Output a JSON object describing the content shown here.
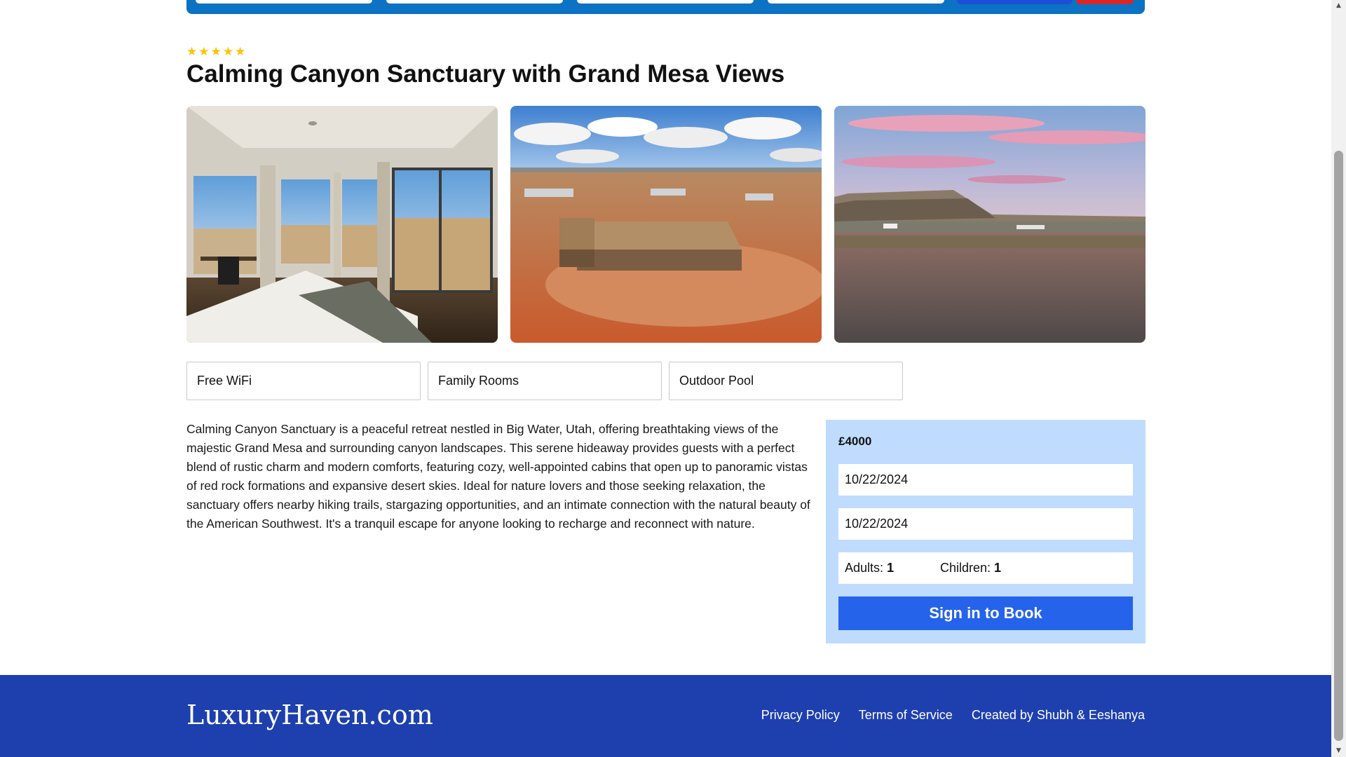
{
  "hotel": {
    "rating": 5,
    "rating_stars": [
      "★",
      "★",
      "★",
      "★",
      "★"
    ],
    "title": "Calming Canyon Sanctuary with Grand Mesa Views",
    "photos": [
      {
        "subject": "bedroom-window-view"
      },
      {
        "subject": "aerial-desert-house"
      },
      {
        "subject": "sunset-mesa-landscape"
      }
    ],
    "facilities": [
      "Free WiFi",
      "Family Rooms",
      "Outdoor Pool"
    ],
    "description": "Calming Canyon Sanctuary is a peaceful retreat nestled in Big Water, Utah, offering breathtaking views of the majestic Grand Mesa and surrounding canyon landscapes. This serene hideaway provides guests with a perfect blend of rustic charm and modern comforts, featuring cozy, well-appointed cabins that open up to panoramic vistas of red rock formations and expansive desert skies. Ideal for nature lovers and those seeking relaxation, the sanctuary offers nearby hiking trails, stargazing opportunities, and an intimate connection with the natural beauty of the American Southwest. It's a tranquil escape for anyone looking to recharge and reconnect with nature."
  },
  "booking": {
    "price": "£4000",
    "check_in": "10/22/2024",
    "check_out": "10/22/2024",
    "adults_label": "Adults:",
    "adults_value": "1",
    "children_label": "Children:",
    "children_value": "1",
    "button_label": "Sign in to Book"
  },
  "footer": {
    "logo": "LuxuryHaven.com",
    "links": [
      "Privacy Policy",
      "Terms of Service",
      "Created by Shubh & Eeshanya"
    ]
  },
  "colors": {
    "search_bar": "#0b72c4",
    "booking_card": "#bfdbfe",
    "book_button": "#2563eb",
    "footer": "#1e40af",
    "stars": "#ffc300"
  },
  "icons": [
    "star-icon",
    "scroll-up-icon",
    "scroll-down-icon"
  ]
}
